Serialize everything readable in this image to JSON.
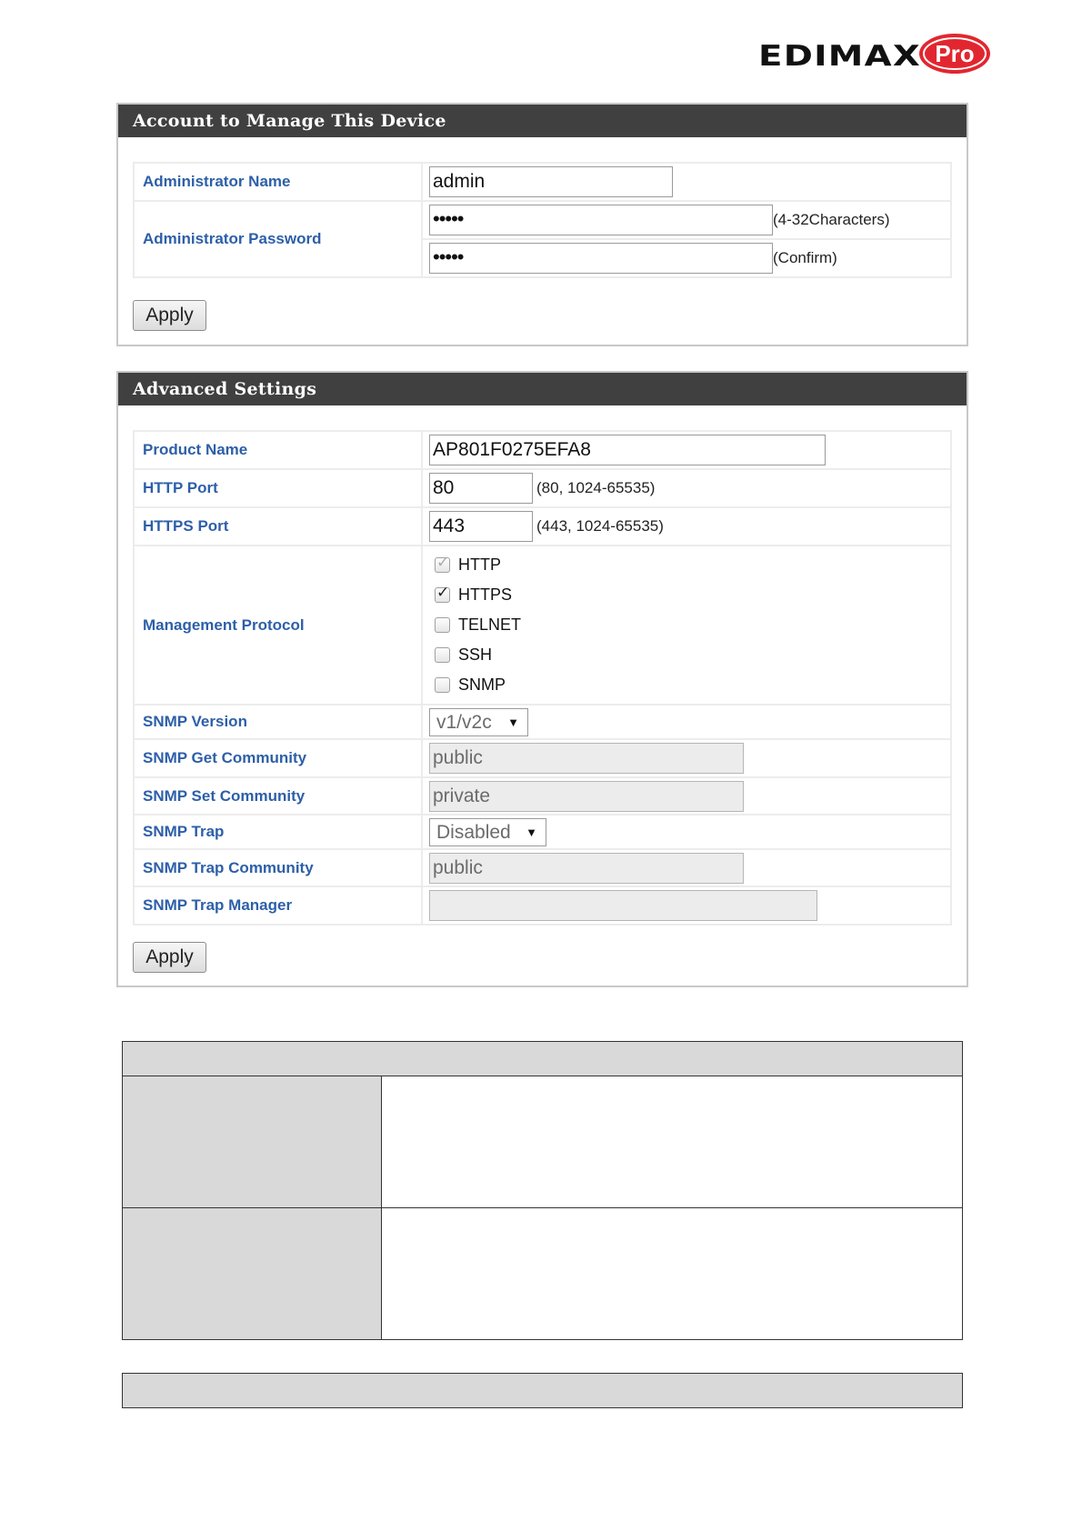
{
  "logo": {
    "brand": "EDIMAX",
    "suffix": "Pro"
  },
  "account_panel": {
    "title": "Account to Manage This Device",
    "admin_name_label": "Administrator Name",
    "admin_name_value": "admin",
    "admin_password_label": "Administrator Password",
    "password_mask": "•••••",
    "password_hint": "(4-32Characters)",
    "confirm_mask": "•••••",
    "confirm_hint": "(Confirm)",
    "apply_label": "Apply"
  },
  "advanced_panel": {
    "title": "Advanced Settings",
    "product_name_label": "Product Name",
    "product_name_value": "AP801F0275EFA8",
    "http_port_label": "HTTP Port",
    "http_port_value": "80",
    "http_port_hint": "(80, 1024-65535)",
    "https_port_label": "HTTPS Port",
    "https_port_value": "443",
    "https_port_hint": "(443, 1024-65535)",
    "mgmt_protocol_label": "Management Protocol",
    "protocols": [
      {
        "label": "HTTP",
        "checked": true,
        "disabled": true
      },
      {
        "label": "HTTPS",
        "checked": true,
        "disabled": false
      },
      {
        "label": "TELNET",
        "checked": false,
        "disabled": false
      },
      {
        "label": "SSH",
        "checked": false,
        "disabled": false
      },
      {
        "label": "SNMP",
        "checked": false,
        "disabled": false
      }
    ],
    "snmp_version_label": "SNMP Version",
    "snmp_version_value": "v1/v2c",
    "snmp_get_label": "SNMP Get Community",
    "snmp_get_value": "public",
    "snmp_set_label": "SNMP Set Community",
    "snmp_set_value": "private",
    "snmp_trap_label": "SNMP Trap",
    "snmp_trap_value": "Disabled",
    "snmp_trap_comm_label": "SNMP Trap Community",
    "snmp_trap_comm_value": "public",
    "snmp_trap_mgr_label": "SNMP Trap Manager",
    "snmp_trap_mgr_value": "",
    "apply_label": "Apply"
  },
  "colors": {
    "header_bg": "#404040",
    "label_blue": "#2d5fa8",
    "doc_shade": "#d9d9d9"
  }
}
